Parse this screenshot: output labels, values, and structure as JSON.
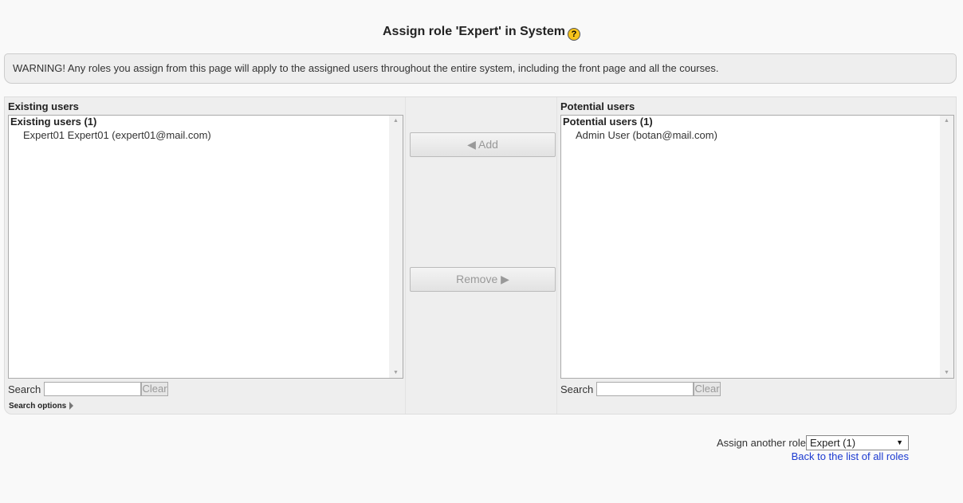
{
  "title": "Assign role 'Expert' in System",
  "help_icon": "?",
  "warning": "WARNING! Any roles you assign from this page will apply to the assigned users throughout the entire system, including the front page and all the courses.",
  "existing": {
    "label": "Existing users",
    "group": "Existing users (1)",
    "items": [
      "Expert01 Expert01 (expert01@mail.com)"
    ],
    "search_label": "Search",
    "search_value": "",
    "clear": "Clear",
    "search_options": "Search options"
  },
  "buttons": {
    "add": "◀ Add",
    "remove": "Remove ▶"
  },
  "potential": {
    "label": "Potential users",
    "group": "Potential users (1)",
    "items": [
      "Admin User (botan@mail.com)"
    ],
    "search_label": "Search",
    "search_value": "",
    "clear": "Clear"
  },
  "footer": {
    "assign_label": "Assign another role",
    "role_selected": "Expert (1)",
    "back_link": "Back to the list of all roles"
  },
  "colors": {
    "link": "#1b3ad1",
    "help_icon": "#f6c31b",
    "panel_bg": "#eeeeee"
  }
}
